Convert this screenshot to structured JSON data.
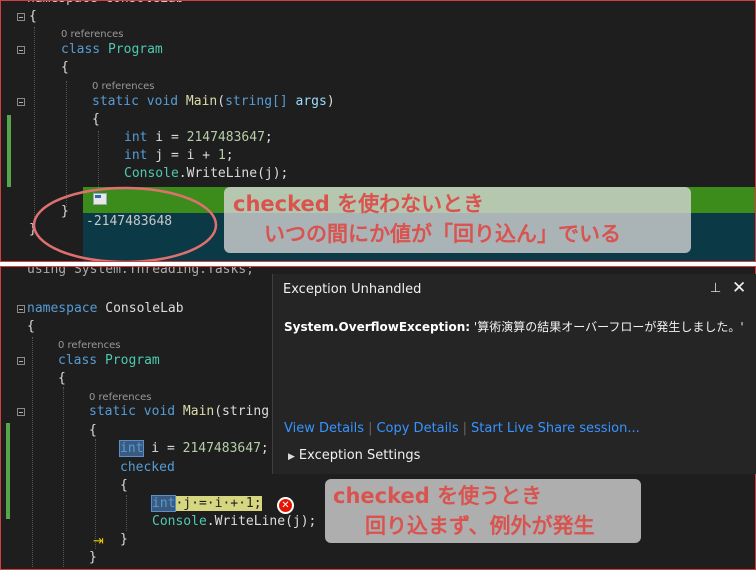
{
  "top_panel": {
    "ns_partial": "namespace ConsoleLab",
    "code": {
      "brace_open": "{",
      "ref_class": "0 references",
      "class_kw": "class",
      "class_name": "Program",
      "class_brace_open": "{",
      "ref_main": "0 references",
      "main_kw": "static void",
      "main_name": "Main",
      "main_params_type": "string[]",
      "main_params_name": "args",
      "main_brace_open": "{",
      "line_i_kw": "int",
      "line_i_rest": " i = ",
      "line_i_num": "2147483647",
      "line_i_end": ";",
      "line_j_kw": "int",
      "line_j_rest": " j = i + ",
      "line_j_num": "1",
      "line_j_end": ";",
      "console_type": "Console",
      "console_call": ".WriteLine(j);",
      "main_brace_close": "}",
      "class_brace_close": "}"
    },
    "console_output": "-2147483648",
    "note_line1": "checked を使わないとき",
    "note_line2": "いつの間にか値が「回り込ん」でいる"
  },
  "bottom_panel": {
    "using_line": "using System.Threading.Tasks;",
    "code": {
      "ns_kw": "namespace",
      "ns_name": "ConsoleLab",
      "ns_brace": "{",
      "ref_class": "0 references",
      "class_kw": "class",
      "class_name": "Program",
      "class_brace": "{",
      "ref_main": "0 references",
      "main_kw": "static void",
      "main_name": "Main",
      "main_params": "(string",
      "main_brace": "{",
      "line_i_kw": "int",
      "line_i_rest": " i = ",
      "line_i_num": "2147483647",
      "line_i_end": ";",
      "checked_kw": "checked",
      "checked_brace": "{",
      "line_j_kw": "int",
      "line_j_rest": "·j·=·i·+·1;",
      "console_type": "Console",
      "console_call": ".WriteLine(j);",
      "checked_brace_close": "}",
      "main_brace_close": "}"
    },
    "dialog": {
      "title": "Exception Unhandled",
      "pin_icon": "pin-icon",
      "close_icon": "close-icon",
      "exception_type": "System.OverflowException:",
      "exception_message": " '算術演算の結果オーバーフローが発生しました。'",
      "view_details": "View Details",
      "copy_details": "Copy Details",
      "live_share": "Start Live Share session...",
      "exception_settings": "Exception Settings"
    },
    "note_line1": "checked を使うとき",
    "note_line2": "回り込まず、例外が発生"
  },
  "colors": {
    "editor_bg": "#1e1e1e",
    "keyword": "#569cd6",
    "type": "#4ec9b0",
    "number": "#b5cea8",
    "console_green": "#3c8c1c",
    "console_dark": "#0b3a46",
    "annotation_red": "#d9534f",
    "link_blue": "#3794ff",
    "error_red": "#e51400"
  }
}
